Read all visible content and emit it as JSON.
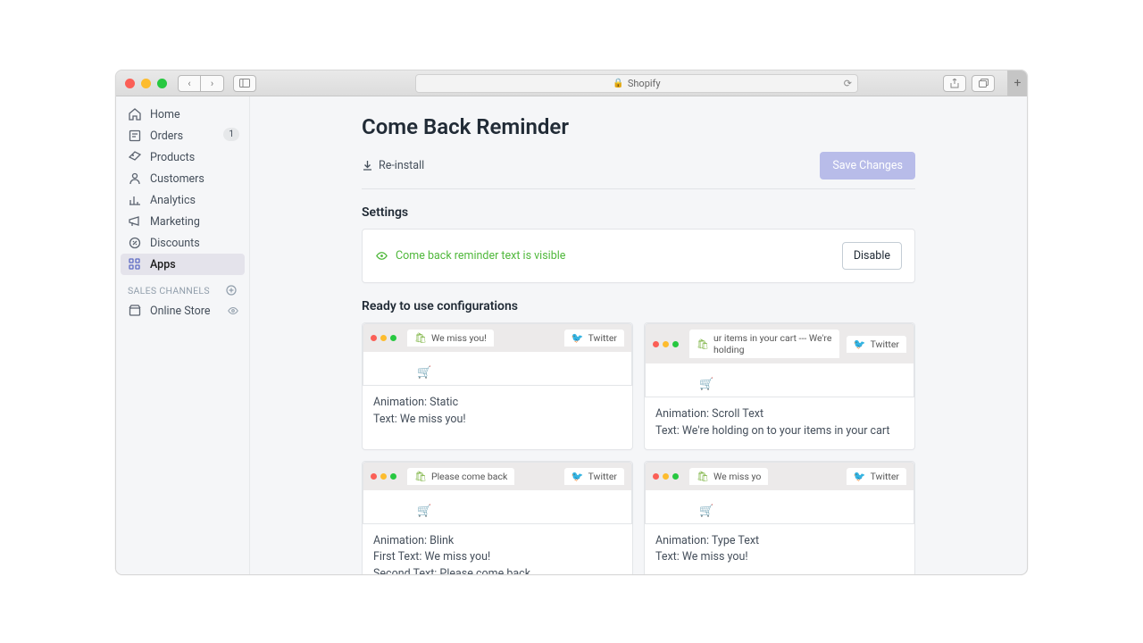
{
  "toolbar": {
    "url_label": "Shopify"
  },
  "sidebar": {
    "items": [
      {
        "label": "Home"
      },
      {
        "label": "Orders",
        "badge": "1"
      },
      {
        "label": "Products"
      },
      {
        "label": "Customers"
      },
      {
        "label": "Analytics"
      },
      {
        "label": "Marketing"
      },
      {
        "label": "Discounts"
      },
      {
        "label": "Apps"
      }
    ],
    "channels_header": "SALES CHANNELS",
    "online_store": "Online Store"
  },
  "page": {
    "title": "Come Back Reminder",
    "reinstall": "Re-install",
    "save": "Save Changes"
  },
  "settings": {
    "header": "Settings",
    "status_text": "Come back reminder text is visible",
    "disable": "Disable"
  },
  "configs": {
    "header": "Ready to use configurations",
    "twitter": "Twitter",
    "cards": [
      {
        "tab": "We miss you!",
        "line1": "Animation: Static",
        "line2": "Text: We miss you!"
      },
      {
        "tab": "ur items in your cart --- We're holding",
        "line1": "Animation: Scroll Text",
        "line2": "Text: We're holding on to your items in your cart"
      },
      {
        "tab": "Please come back",
        "line1": "Animation: Blink",
        "line2": "First Text: We miss you!",
        "line3": "Second Text: Please come back"
      },
      {
        "tab": "We miss yo",
        "line1": "Animation: Type Text",
        "line2": "Text: We miss you!"
      }
    ]
  }
}
